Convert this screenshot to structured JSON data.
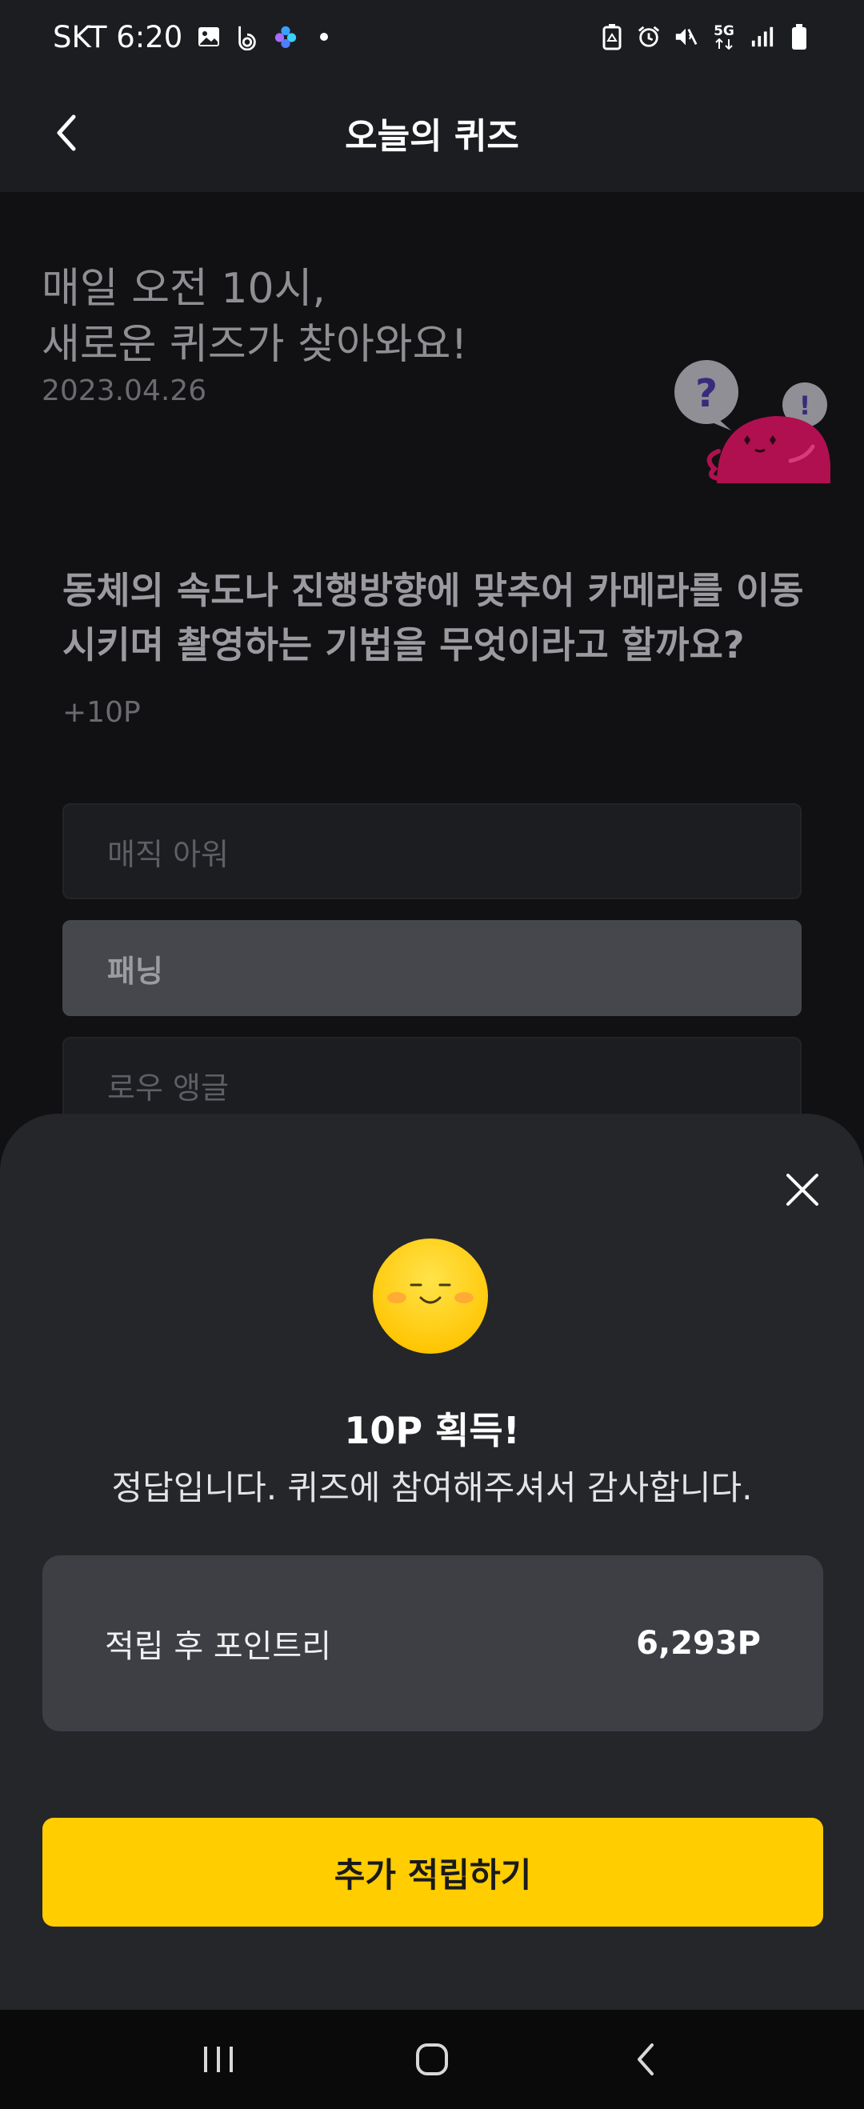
{
  "status_bar": {
    "carrier_time": "SKT 6:20",
    "icons": [
      "gallery-icon",
      "b-app-icon",
      "spark-app-icon",
      "dot-icon",
      "recycle-icon",
      "alarm-icon",
      "mute-icon",
      "5g-icon",
      "signal-icon",
      "battery-icon"
    ],
    "network_label": "5G"
  },
  "header": {
    "title": "오늘의 퀴즈",
    "back_icon": "chevron-left-icon"
  },
  "intro": {
    "line1": "매일 오전 10시,",
    "line2": "새로운 퀴즈가 찾아와요!",
    "date": "2023.04.26"
  },
  "mascot": {
    "bubble_left": "?",
    "bubble_right": "!"
  },
  "quiz": {
    "question_line1": "동체의 속도나 진행방향에 맞추어 카메라를 이동",
    "question_line2": "시키며 촬영하는 기법을 무엇이라고 할까요?",
    "points": "+10P",
    "options": [
      {
        "label": "매직 아워",
        "selected": false
      },
      {
        "label": "패닝",
        "selected": true
      },
      {
        "label": "로우 앵글",
        "selected": false
      }
    ]
  },
  "result_sheet": {
    "title": "10P 획득!",
    "message": "정답입니다. 퀴즈에 참여해주셔서 감사합니다.",
    "balance_label": "적립 후 포인트리",
    "balance_value": "6,293P",
    "cta_label": "추가 적립하기",
    "close_icon": "close-icon"
  },
  "colors": {
    "background": "#111113",
    "sheet": "#252629",
    "card": "#3d3f45",
    "accent": "#ffcd00",
    "mascot": "#b0104f"
  },
  "nav_bar": {
    "icons": [
      "recent-apps-icon",
      "home-icon",
      "back-icon"
    ]
  }
}
